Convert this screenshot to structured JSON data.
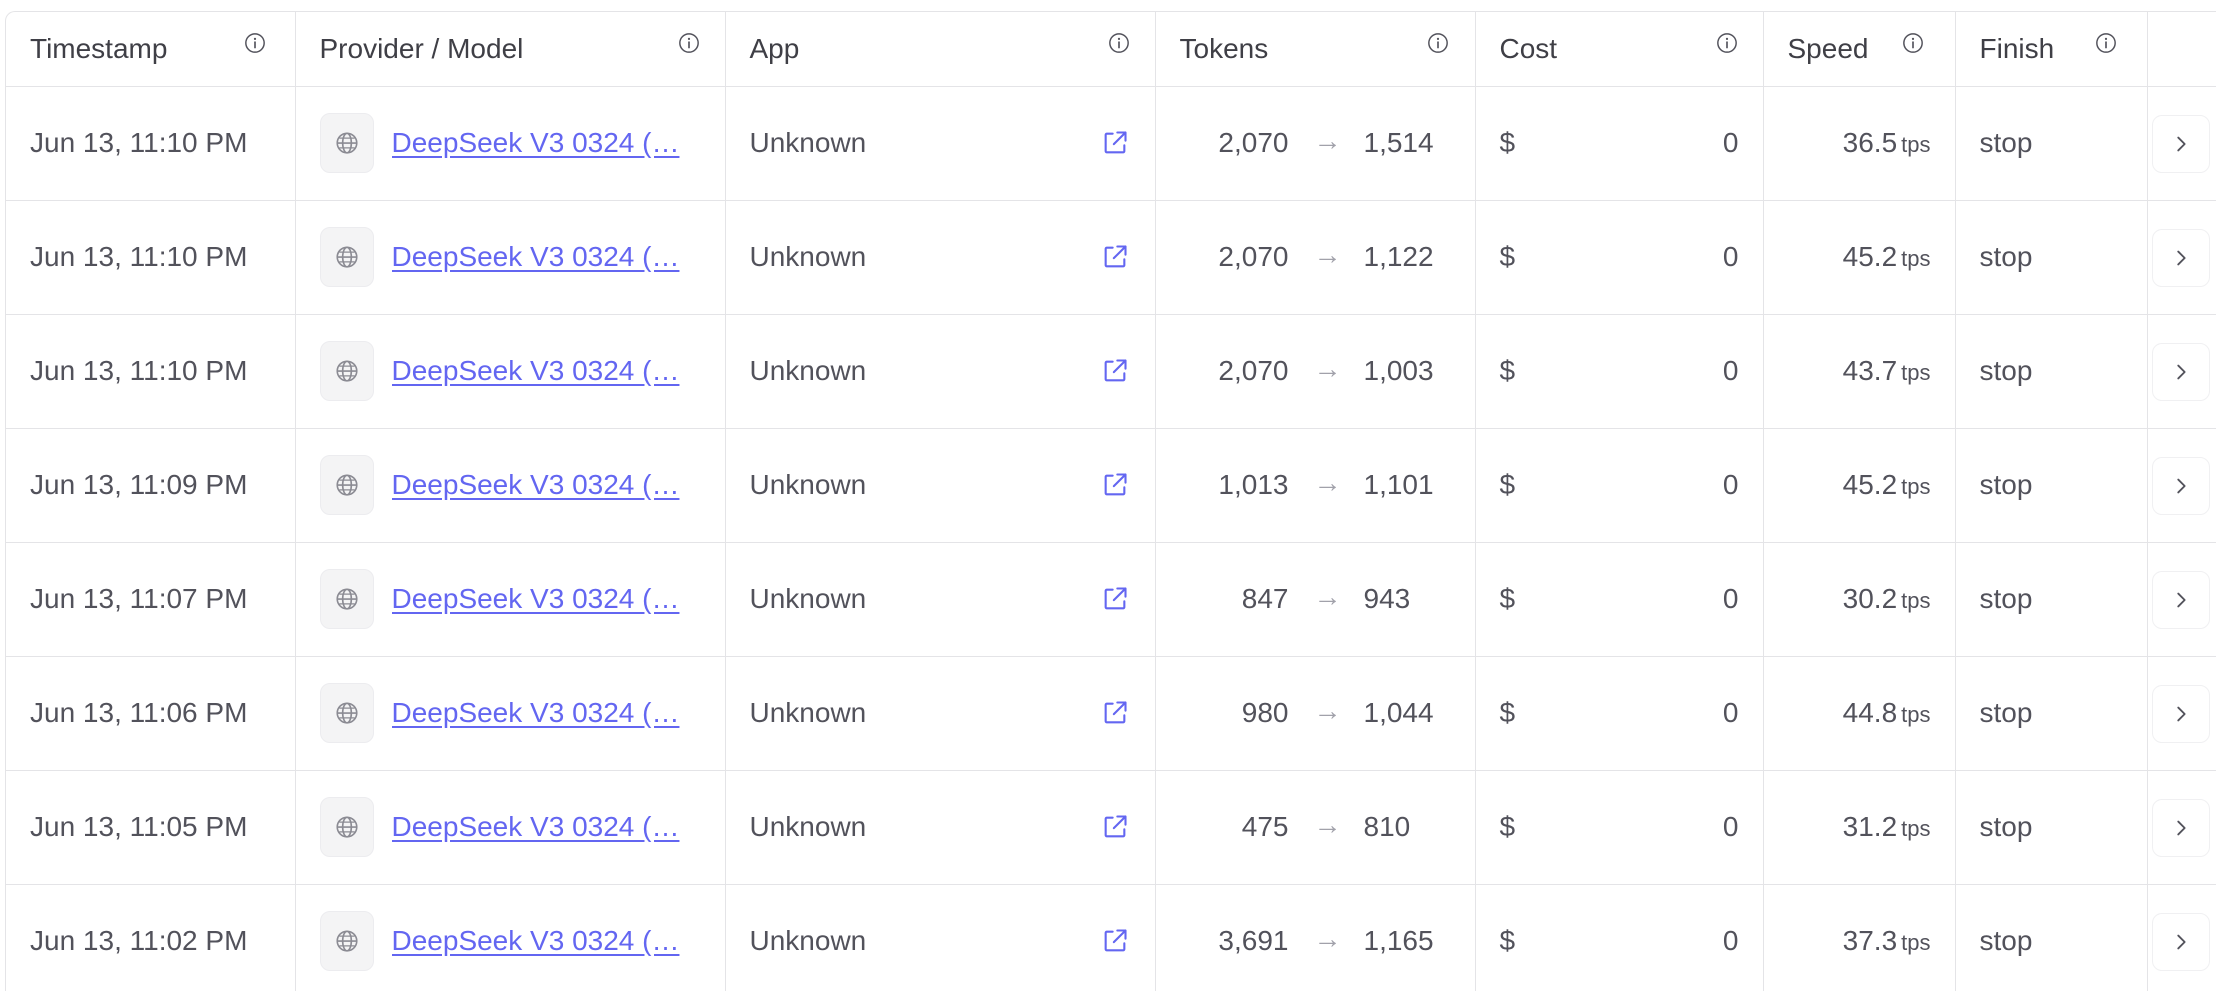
{
  "columns": {
    "timestamp": "Timestamp",
    "provider_model": "Provider / Model",
    "app": "App",
    "tokens": "Tokens",
    "cost": "Cost",
    "speed": "Speed",
    "finish": "Finish"
  },
  "icons": {
    "info": "info-icon",
    "model": "globe-icon",
    "external": "external-link-icon",
    "chevron": "chevron-right-icon",
    "arrow": "arrow-right-icon"
  },
  "colors": {
    "link": "#6366f1",
    "border": "#e4e4e7",
    "text": "#52525b"
  },
  "rows": [
    {
      "timestamp": "Jun 13, 11:10 PM",
      "model": "DeepSeek V3 0324 (…",
      "app": "Unknown",
      "tokens_in": "2,070",
      "arrow": "→",
      "tokens_out": "1,514",
      "currency": "$",
      "cost": "0",
      "speed": "36.5",
      "speed_unit": "tps",
      "finish": "stop"
    },
    {
      "timestamp": "Jun 13, 11:10 PM",
      "model": "DeepSeek V3 0324 (…",
      "app": "Unknown",
      "tokens_in": "2,070",
      "arrow": "→",
      "tokens_out": "1,122",
      "currency": "$",
      "cost": "0",
      "speed": "45.2",
      "speed_unit": "tps",
      "finish": "stop"
    },
    {
      "timestamp": "Jun 13, 11:10 PM",
      "model": "DeepSeek V3 0324 (…",
      "app": "Unknown",
      "tokens_in": "2,070",
      "arrow": "→",
      "tokens_out": "1,003",
      "currency": "$",
      "cost": "0",
      "speed": "43.7",
      "speed_unit": "tps",
      "finish": "stop"
    },
    {
      "timestamp": "Jun 13, 11:09 PM",
      "model": "DeepSeek V3 0324 (…",
      "app": "Unknown",
      "tokens_in": "1,013",
      "arrow": "→",
      "tokens_out": "1,101",
      "currency": "$",
      "cost": "0",
      "speed": "45.2",
      "speed_unit": "tps",
      "finish": "stop"
    },
    {
      "timestamp": "Jun 13, 11:07 PM",
      "model": "DeepSeek V3 0324 (…",
      "app": "Unknown",
      "tokens_in": "847",
      "arrow": "→",
      "tokens_out": "943",
      "currency": "$",
      "cost": "0",
      "speed": "30.2",
      "speed_unit": "tps",
      "finish": "stop"
    },
    {
      "timestamp": "Jun 13, 11:06 PM",
      "model": "DeepSeek V3 0324 (…",
      "app": "Unknown",
      "tokens_in": "980",
      "arrow": "→",
      "tokens_out": "1,044",
      "currency": "$",
      "cost": "0",
      "speed": "44.8",
      "speed_unit": "tps",
      "finish": "stop"
    },
    {
      "timestamp": "Jun 13, 11:05 PM",
      "model": "DeepSeek V3 0324 (…",
      "app": "Unknown",
      "tokens_in": "475",
      "arrow": "→",
      "tokens_out": "810",
      "currency": "$",
      "cost": "0",
      "speed": "31.2",
      "speed_unit": "tps",
      "finish": "stop"
    },
    {
      "timestamp": "Jun 13, 11:02 PM",
      "model": "DeepSeek V3 0324 (…",
      "app": "Unknown",
      "tokens_in": "3,691",
      "arrow": "→",
      "tokens_out": "1,165",
      "currency": "$",
      "cost": "0",
      "speed": "37.3",
      "speed_unit": "tps",
      "finish": "stop"
    }
  ]
}
